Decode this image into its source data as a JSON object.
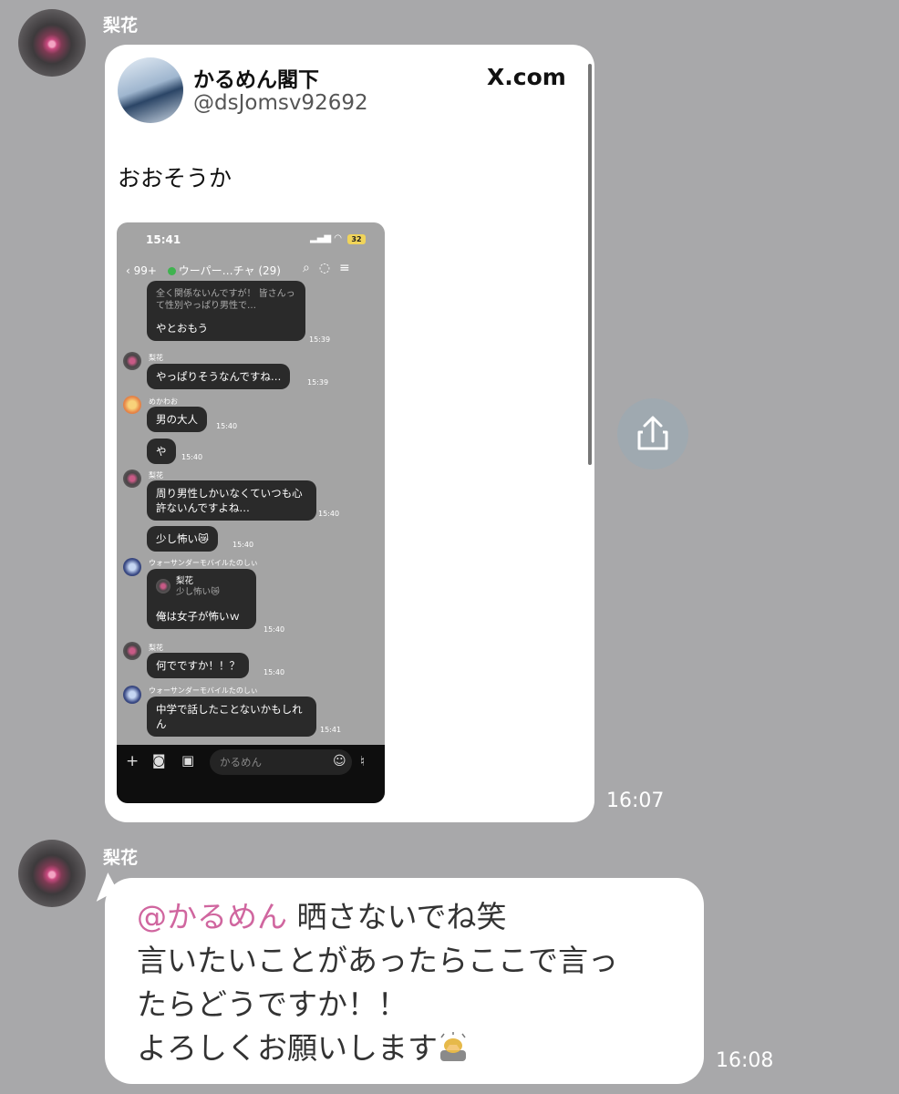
{
  "messages": [
    {
      "sender": "梨花",
      "time": "16:07",
      "shared_post": {
        "author_name": "かるめん閣下",
        "author_handle": "@dsJomsv92692",
        "brand": "X.com",
        "text": "おおそうか",
        "embedded_screenshot": {
          "clock": "15:41",
          "battery": "32",
          "back_count": "99+",
          "chat_title": "ウーパー…チャ (29)",
          "quote_text": "全く関係ないんですが！ 皆さんって性別やっぱり男性で…",
          "items": [
            {
              "name": "",
              "text": "やとおもう",
              "time": "15:39"
            },
            {
              "name": "梨花",
              "text": "やっぱりそうなんですね…",
              "time": "15:39"
            },
            {
              "name": "めかわお",
              "text": "男の大人",
              "time": "15:40"
            },
            {
              "name": "",
              "text": "や",
              "time": "15:40"
            },
            {
              "name": "梨花",
              "text": "周り男性しかいなくていつも心許ないんですよね…",
              "time": "15:40"
            },
            {
              "name": "",
              "text": "少し怖い😿",
              "time": "15:40"
            },
            {
              "name": "ウォーサンダーモバイルたのしぃ",
              "reply_name": "梨花",
              "reply_text": "少し怖い😿",
              "text": "俺は女子が怖いｗ",
              "time": "15:40"
            },
            {
              "name": "梨花",
              "text": "何でですか！！？",
              "time": "15:40"
            },
            {
              "name": "ウォーサンダーモバイルたのしぃ",
              "text": "中学で話したことないかもしれん",
              "time": "15:41"
            }
          ],
          "input_placeholder": "かるめん"
        }
      }
    },
    {
      "sender": "梨花",
      "time": "16:08",
      "mention": "@かるめん",
      "lines": [
        "晒さないでね笑",
        "言いたいことがあったらここで言っ",
        "たらどうですか！！",
        "よろしくお願いします"
      ],
      "emoji_icon": "person-bowing-icon"
    }
  ],
  "icons": {
    "share": "share-icon",
    "plus": "plus-icon",
    "camera": "camera-icon",
    "image": "image-icon",
    "emoji": "smiley-icon",
    "mic": "mic-icon"
  },
  "colors": {
    "background": "#a8a8aa",
    "mention": "#d0669f",
    "bubble": "#ffffff"
  }
}
